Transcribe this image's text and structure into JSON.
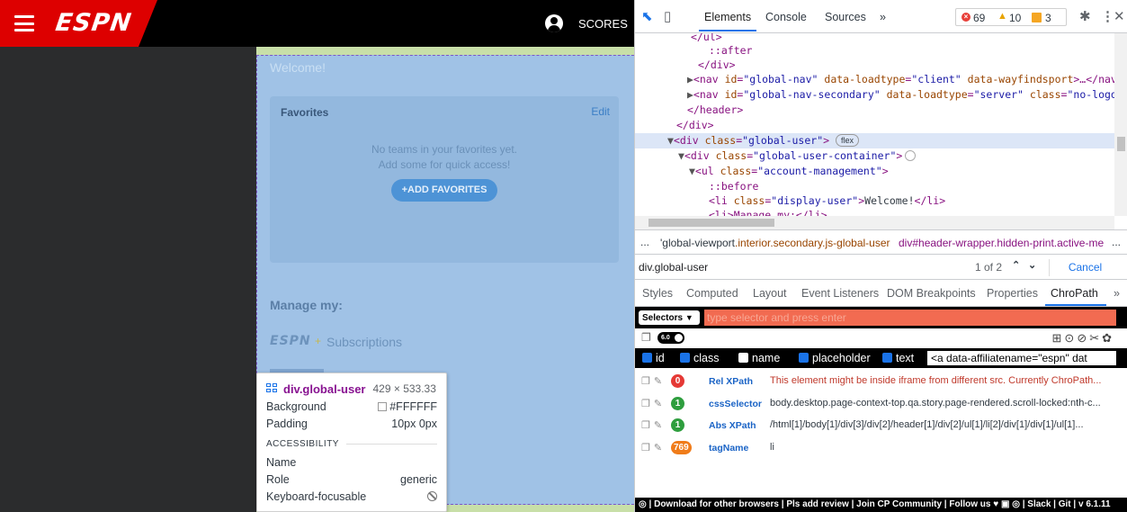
{
  "espn": {
    "logo": "ESPN",
    "scores": "SCORES",
    "welcome": "Welcome!",
    "favorites": {
      "title": "Favorites",
      "edit": "Edit",
      "line1": "No teams in your favorites yet.",
      "line2": "Add some for quick access!",
      "add_button": "+ADD FAVORITES"
    },
    "manage": "Manage my:",
    "subscriptions": {
      "logo": "ESPN",
      "plus": "+",
      "label": "Subscriptions"
    },
    "tooltip": {
      "selector": "div.global-user",
      "size": "429 × 533.33",
      "rows": [
        {
          "label": "Background",
          "value": "#FFFFFF"
        },
        {
          "label": "Padding",
          "value": "10px 0px"
        }
      ],
      "section": "ACCESSIBILITY",
      "a11y": [
        {
          "label": "Name",
          "value": ""
        },
        {
          "label": "Role",
          "value": "generic"
        },
        {
          "label": "Keyboard-focusable",
          "value": ""
        }
      ]
    }
  },
  "devtools": {
    "tabs": [
      "Elements",
      "Console",
      "Sources",
      "»"
    ],
    "badges": {
      "errors": "69",
      "warnings": "10",
      "issues": "3"
    },
    "dom": {
      "l1": "</ul>",
      "l2": "::after",
      "l3": "</div>",
      "l4_attr1": "\"global-nav\"",
      "l4_attr2": "\"client\"",
      "l4_attr3": "\"wayfindsport\"",
      "l5_attr1": "\"global-nav-secondary\"",
      "l5_attr2": "\"server\"",
      "l5_attr3": "\"no-logo glo",
      "l6": "</header>",
      "l7": "</div>",
      "l8_attr": "\"global-user\"",
      "flex": "flex",
      "l9_attr": "\"global-user-container\"",
      "l10_attr": "\"account-management\"",
      "l11": "::before",
      "l12_attr": "\"display-user\"",
      "l12_text": "Welcome!",
      "l13": "<li>Manage my:</li>"
    },
    "breadcrumb": {
      "ellipsis": "...",
      "part1_id": "'global-viewport",
      "part1_cls": ".interior.secondary.js-global-user",
      "part2": "div#header-wrapper.hidden-print.active-me",
      "more": "..."
    },
    "search": {
      "value": "div.global-user",
      "count": "1 of 2",
      "cancel": "Cancel"
    },
    "subtabs": [
      "Styles",
      "Computed",
      "Layout",
      "Event Listeners",
      "DOM Breakpoints",
      "Properties",
      "ChroPath",
      "»"
    ],
    "chropath": {
      "selectors_btn": "Selectors",
      "placeholder": "type selector and press enter",
      "version": "6.0",
      "checkboxes": [
        {
          "label": "id",
          "checked": true
        },
        {
          "label": "class",
          "checked": true
        },
        {
          "label": "name",
          "checked": false
        },
        {
          "label": "placeholder",
          "checked": true
        },
        {
          "label": "text",
          "checked": true
        }
      ],
      "attr_value": "<a data-affiliatename=\"espn\" dat",
      "results": [
        {
          "count": "0",
          "name": "Rel XPath",
          "value": "This element might be inside iframe from different src. Currently ChroPath...",
          "color": "#e53935"
        },
        {
          "count": "1",
          "name": "cssSelector",
          "value": "body.desktop.page-context-top.qa.story.page-rendered.scroll-locked:nth-c...",
          "color": "#2e9e3e"
        },
        {
          "count": "1",
          "name": "Abs XPath",
          "value": "/html[1]/body[1]/div[3]/div[2]/header[1]/div[2]/ul[1]/li[2]/div[1]/div[1]/ul[1]...",
          "color": "#2e9e3e"
        },
        {
          "count": "769",
          "name": "tagName",
          "value": "li",
          "color": "#f07c1a"
        }
      ],
      "footer": "| Download for other browsers | Pls add review | Join CP Community | Follow us ♥ ▣ ◎ | Slack | Git | v 6.1.11"
    }
  }
}
